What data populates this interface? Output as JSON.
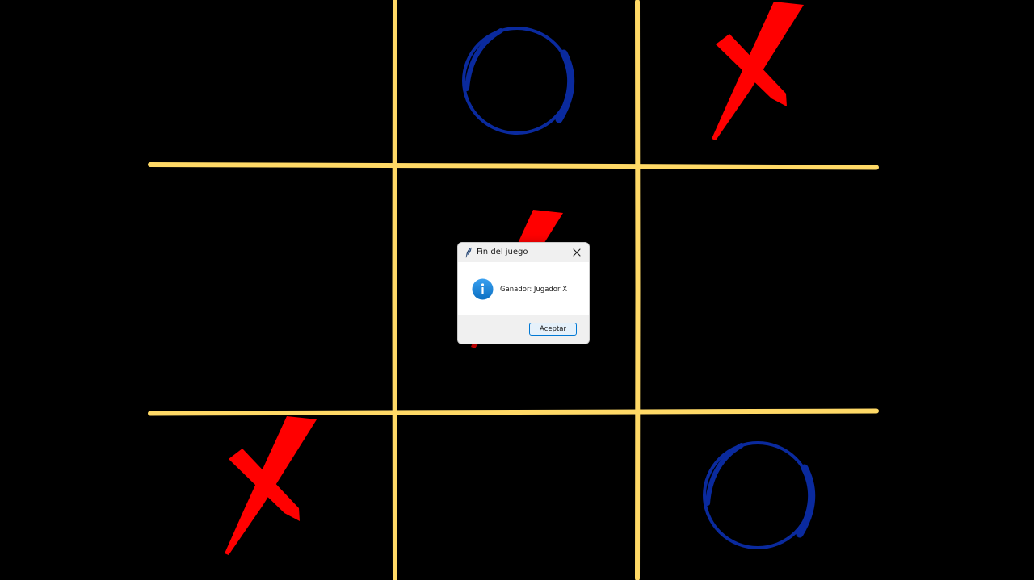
{
  "game": {
    "board": [
      [
        "",
        "O",
        "X"
      ],
      [
        "",
        "X",
        ""
      ],
      [
        "X",
        "",
        "O"
      ]
    ],
    "colors": {
      "background": "#000000",
      "grid": "#ffd966",
      "x_mark": "#ff0000",
      "o_mark": "#0a2a9e"
    }
  },
  "dialog": {
    "title": "Fin del juego",
    "message": "Ganador: Jugador X",
    "ok_label": "Aceptar",
    "app_icon": "feather-icon",
    "info_icon": "info-icon",
    "close_icon": "close-icon"
  }
}
